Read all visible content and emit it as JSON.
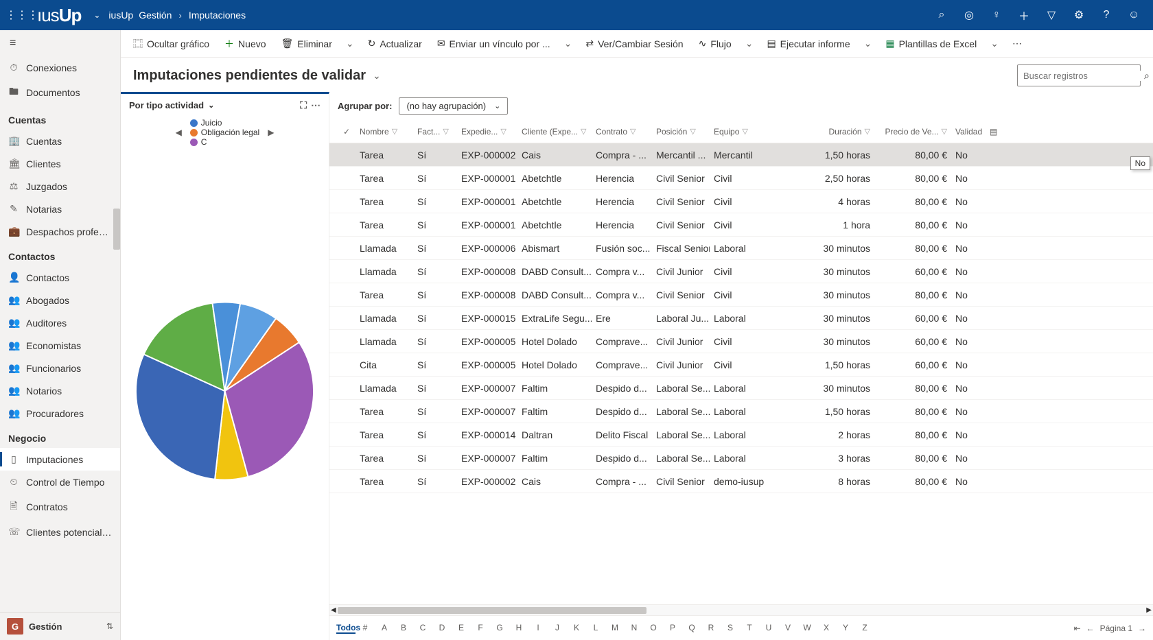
{
  "app": {
    "name": "iusUp",
    "logo_text": "iusUp"
  },
  "breadcrumb": {
    "root": "iusUp",
    "area": "Gestión",
    "page": "Imputaciones"
  },
  "topicons": [
    "search",
    "target",
    "lightbulb",
    "plus",
    "filter",
    "gear",
    "help",
    "user"
  ],
  "sidebar": {
    "top_items": [
      {
        "icon": "⏱",
        "label": "Conexiones"
      },
      {
        "icon": "🖿",
        "label": "Documentos"
      }
    ],
    "groups": [
      {
        "title": "Cuentas",
        "items": [
          {
            "icon": "🏢",
            "label": "Cuentas"
          },
          {
            "icon": "🏛",
            "label": "Clientes"
          },
          {
            "icon": "⚖",
            "label": "Juzgados"
          },
          {
            "icon": "✎",
            "label": "Notarias"
          },
          {
            "icon": "💼",
            "label": "Despachos profesi..."
          }
        ]
      },
      {
        "title": "Contactos",
        "items": [
          {
            "icon": "👤",
            "label": "Contactos"
          },
          {
            "icon": "👥",
            "label": "Abogados"
          },
          {
            "icon": "👥",
            "label": "Auditores"
          },
          {
            "icon": "👥",
            "label": "Economistas"
          },
          {
            "icon": "👥",
            "label": "Funcionarios"
          },
          {
            "icon": "👥",
            "label": "Notarios"
          },
          {
            "icon": "👥",
            "label": "Procuradores"
          }
        ]
      },
      {
        "title": "Negocio",
        "items": [
          {
            "icon": "▯",
            "label": "Imputaciones",
            "selected": true
          },
          {
            "icon": "⏲",
            "label": "Control de Tiempo"
          },
          {
            "icon": "🖹",
            "label": "Contratos"
          },
          {
            "icon": "☏",
            "label": "Clientes potenciales"
          }
        ]
      }
    ],
    "bottom_app": {
      "tile": "G",
      "label": "Gestión"
    }
  },
  "commands": {
    "hide_chart": "Ocultar gráfico",
    "new": "Nuevo",
    "delete": "Eliminar",
    "refresh": "Actualizar",
    "email_link": "Enviar un vínculo por ...",
    "session": "Ver/Cambiar Sesión",
    "flow": "Flujo",
    "run_report": "Ejecutar informe",
    "excel": "Plantillas de Excel"
  },
  "view": {
    "title": "Imputaciones pendientes de validar"
  },
  "search_placeholder": "Buscar registros",
  "chart": {
    "title": "Por tipo actividad",
    "legend": [
      {
        "color": "#3a77c9",
        "label": "Juicio"
      },
      {
        "color": "#e8792e",
        "label": "Obligación legal"
      },
      {
        "color": "#9b59b6",
        "label": "C"
      }
    ]
  },
  "chart_data": {
    "type": "pie",
    "title": "Por tipo actividad",
    "series": [
      {
        "name": "Juicio (light blue)",
        "color": "#5ea0e2",
        "value": 7
      },
      {
        "name": "Obligación legal",
        "color": "#e8792e",
        "value": 6
      },
      {
        "name": "C (purple)",
        "color": "#9b59b6",
        "value": 30
      },
      {
        "name": "Yellow",
        "color": "#f1c40f",
        "value": 6
      },
      {
        "name": "Blue",
        "color": "#3a66b5",
        "value": 30
      },
      {
        "name": "Green",
        "color": "#5fad46",
        "value": 16
      },
      {
        "name": "Small blue",
        "color": "#4a90d9",
        "value": 5
      }
    ]
  },
  "group_by": {
    "label": "Agrupar por:",
    "value": "(no hay agrupación)"
  },
  "columns": [
    "Nombre",
    "Fact...",
    "Expedie...",
    "Cliente (Expe...",
    "Contrato",
    "Posición",
    "Equipo",
    "Duración",
    "Precio de Ve...",
    "Validad"
  ],
  "rows": [
    {
      "nombre": "Tarea",
      "fact": "Sí",
      "exped": "EXP-000002",
      "cliente": "Cais",
      "contrato": "Compra - ...",
      "posicion": "Mercantil ...",
      "equipo": "Mercantil",
      "duracion": "1,50 horas",
      "precio": "80,00 €",
      "validado": "No",
      "selected": true
    },
    {
      "nombre": "Tarea",
      "fact": "Sí",
      "exped": "EXP-000001",
      "cliente": "Abetchtle",
      "contrato": "Herencia",
      "posicion": "Civil Senior",
      "equipo": "Civil",
      "duracion": "2,50 horas",
      "precio": "80,00 €",
      "validado": "No"
    },
    {
      "nombre": "Tarea",
      "fact": "Sí",
      "exped": "EXP-000001",
      "cliente": "Abetchtle",
      "contrato": "Herencia",
      "posicion": "Civil Senior",
      "equipo": "Civil",
      "duracion": "4 horas",
      "precio": "80,00 €",
      "validado": "No"
    },
    {
      "nombre": "Tarea",
      "fact": "Sí",
      "exped": "EXP-000001",
      "cliente": "Abetchtle",
      "contrato": "Herencia",
      "posicion": "Civil Senior",
      "equipo": "Civil",
      "duracion": "1 hora",
      "precio": "80,00 €",
      "validado": "No"
    },
    {
      "nombre": "Llamada",
      "fact": "Sí",
      "exped": "EXP-000006",
      "cliente": "Abismart",
      "contrato": "Fusión soc...",
      "posicion": "Fiscal Senior",
      "equipo": "Laboral",
      "duracion": "30 minutos",
      "precio": "80,00 €",
      "validado": "No"
    },
    {
      "nombre": "Llamada",
      "fact": "Sí",
      "exped": "EXP-000008",
      "cliente": "DABD Consult...",
      "contrato": "Compra v...",
      "posicion": "Civil Junior",
      "equipo": "Civil",
      "duracion": "30 minutos",
      "precio": "60,00 €",
      "validado": "No"
    },
    {
      "nombre": "Tarea",
      "fact": "Sí",
      "exped": "EXP-000008",
      "cliente": "DABD Consult...",
      "contrato": "Compra v...",
      "posicion": "Civil Senior",
      "equipo": "Civil",
      "duracion": "30 minutos",
      "precio": "80,00 €",
      "validado": "No"
    },
    {
      "nombre": "Llamada",
      "fact": "Sí",
      "exped": "EXP-000015",
      "cliente": "ExtraLife Segu...",
      "contrato": "Ere",
      "posicion": "Laboral Ju...",
      "equipo": "Laboral",
      "duracion": "30 minutos",
      "precio": "60,00 €",
      "validado": "No"
    },
    {
      "nombre": "Llamada",
      "fact": "Sí",
      "exped": "EXP-000005",
      "cliente": "Hotel Dolado",
      "contrato": "Comprave...",
      "posicion": "Civil Junior",
      "equipo": "Civil",
      "duracion": "30 minutos",
      "precio": "60,00 €",
      "validado": "No"
    },
    {
      "nombre": "Cita",
      "fact": "Sí",
      "exped": "EXP-000005",
      "cliente": "Hotel Dolado",
      "contrato": "Comprave...",
      "posicion": "Civil Junior",
      "equipo": "Civil",
      "duracion": "1,50 horas",
      "precio": "60,00 €",
      "validado": "No"
    },
    {
      "nombre": "Llamada",
      "fact": "Sí",
      "exped": "EXP-000007",
      "cliente": "Faltim",
      "contrato": "Despido d...",
      "posicion": "Laboral Se...",
      "equipo": "Laboral",
      "duracion": "30 minutos",
      "precio": "80,00 €",
      "validado": "No"
    },
    {
      "nombre": "Tarea",
      "fact": "Sí",
      "exped": "EXP-000007",
      "cliente": "Faltim",
      "contrato": "Despido d...",
      "posicion": "Laboral Se...",
      "equipo": "Laboral",
      "duracion": "1,50 horas",
      "precio": "80,00 €",
      "validado": "No"
    },
    {
      "nombre": "Tarea",
      "fact": "Sí",
      "exped": "EXP-000014",
      "cliente": "Daltran",
      "contrato": "Delito Fiscal",
      "posicion": "Laboral Se...",
      "equipo": "Laboral",
      "duracion": "2 horas",
      "precio": "80,00 €",
      "validado": "No"
    },
    {
      "nombre": "Tarea",
      "fact": "Sí",
      "exped": "EXP-000007",
      "cliente": "Faltim",
      "contrato": "Despido d...",
      "posicion": "Laboral Se...",
      "equipo": "Laboral",
      "duracion": "3 horas",
      "precio": "80,00 €",
      "validado": "No"
    },
    {
      "nombre": "Tarea",
      "fact": "Sí",
      "exped": "EXP-000002",
      "cliente": "Cais",
      "contrato": "Compra - ...",
      "posicion": "Civil Senior",
      "equipo": "demo-iusup",
      "duracion": "8 horas",
      "precio": "80,00 €",
      "validado": "No"
    }
  ],
  "footer": {
    "letters": [
      "Todos",
      "#",
      "A",
      "B",
      "C",
      "D",
      "E",
      "F",
      "G",
      "H",
      "I",
      "J",
      "K",
      "L",
      "M",
      "N",
      "O",
      "P",
      "Q",
      "R",
      "S",
      "T",
      "U",
      "V",
      "W",
      "X",
      "Y",
      "Z"
    ],
    "page_label": "Página 1"
  },
  "tooltip": "No"
}
